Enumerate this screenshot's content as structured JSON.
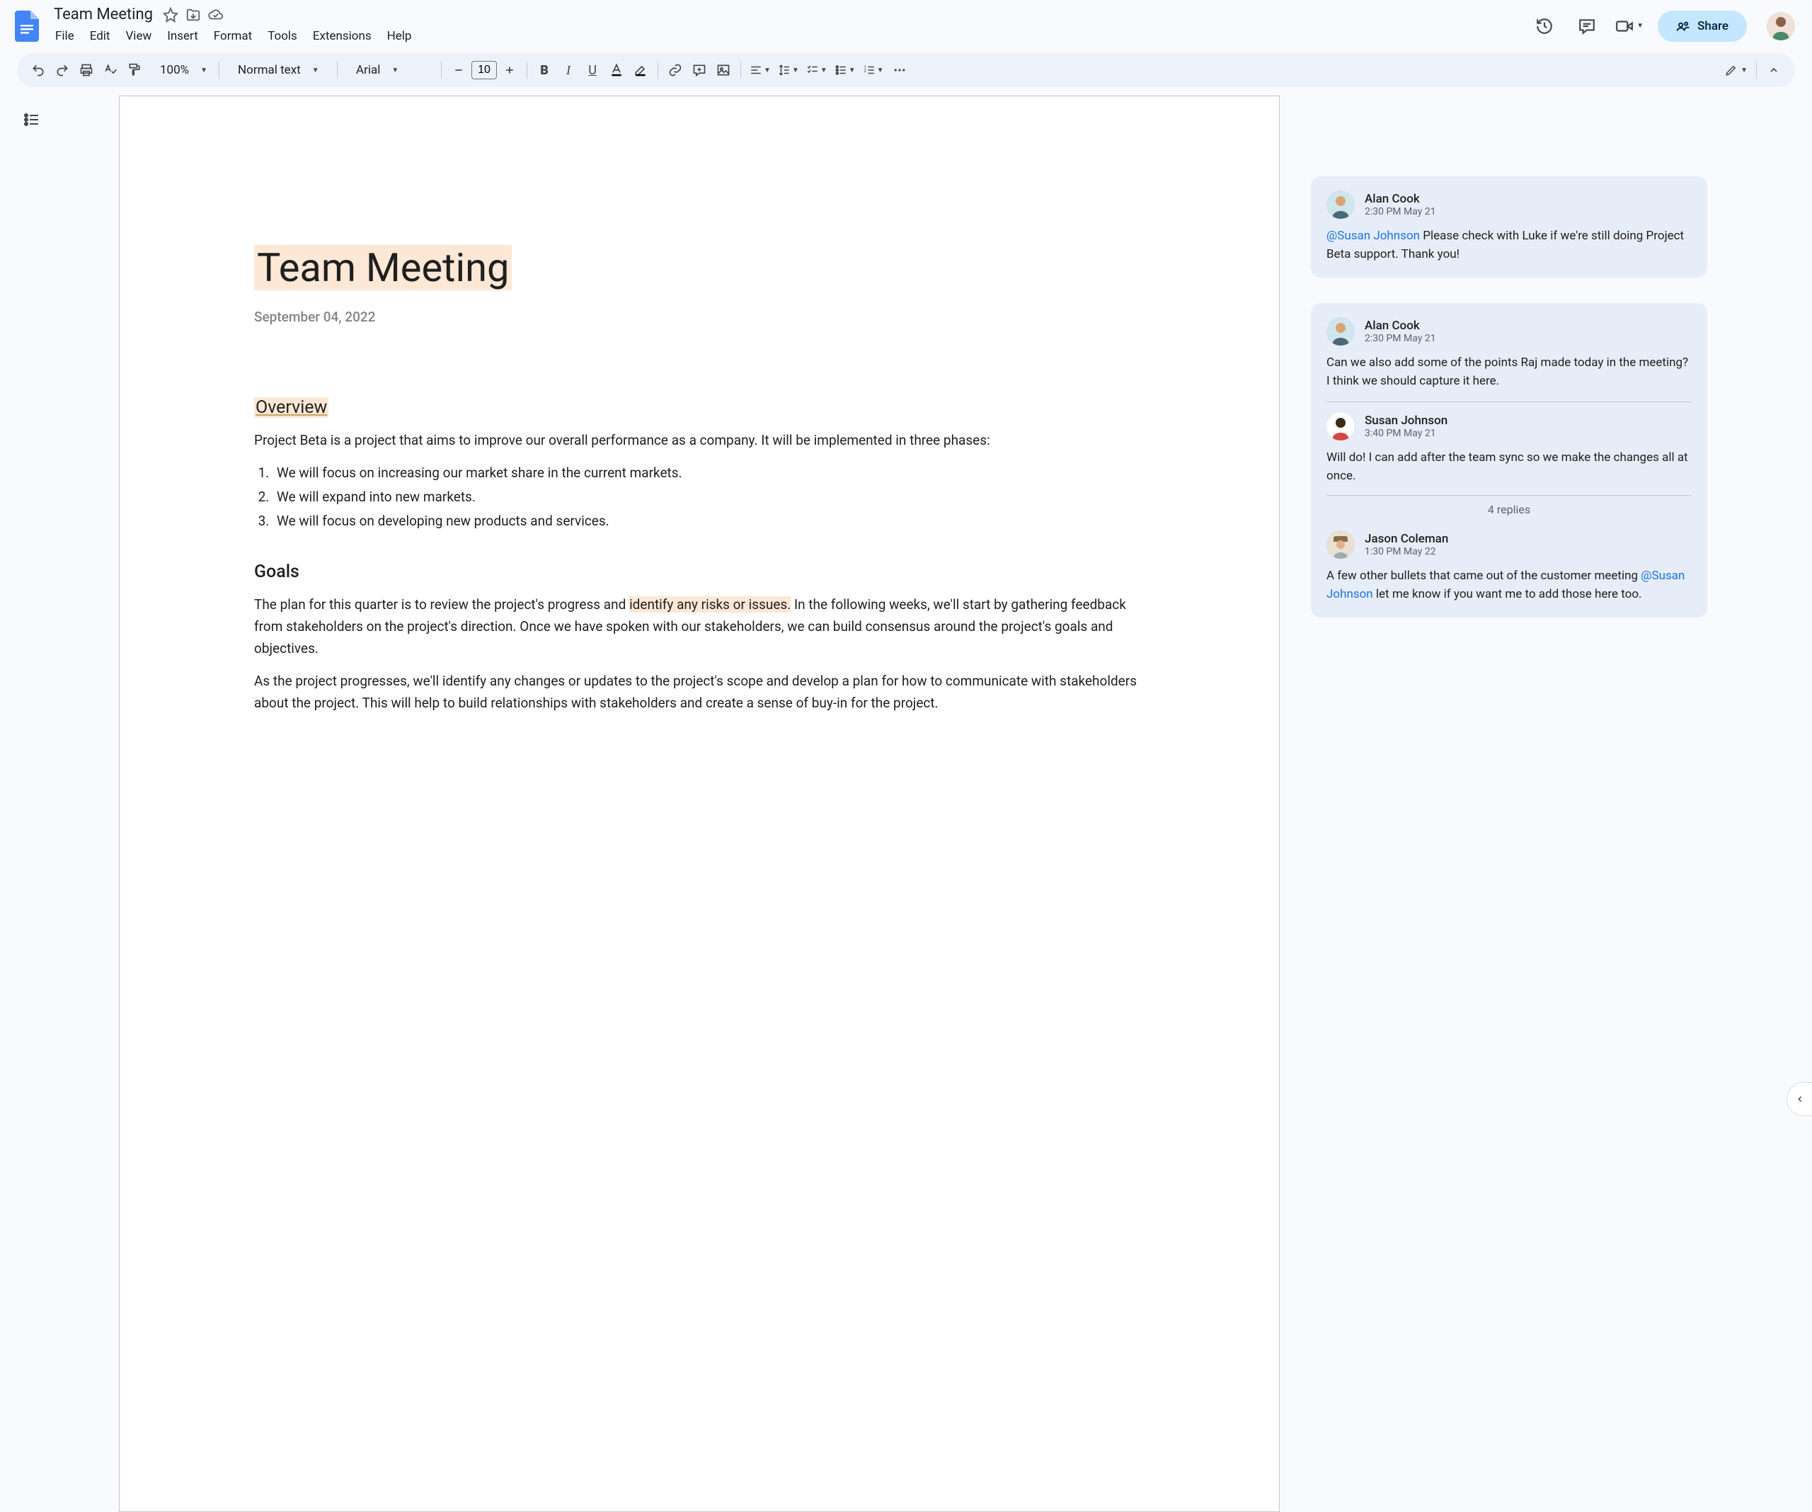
{
  "header": {
    "doc_title": "Team Meeting",
    "menus": [
      "File",
      "Edit",
      "View",
      "Insert",
      "Format",
      "Tools",
      "Extensions",
      "Help"
    ],
    "share_label": "Share"
  },
  "toolbar": {
    "zoom": "100%",
    "style": "Normal text",
    "font": "Arial",
    "font_size": "10"
  },
  "document": {
    "title": "Team Meeting",
    "date": "September 04, 2022",
    "overview_heading": "Overview",
    "overview_text": "Project Beta is a project that aims to improve our overall performance as a company. It will be implemented in three phases:",
    "phases": [
      "We will focus on increasing our market share in the current markets.",
      "We will expand into new markets.",
      "We will focus on developing new products and services."
    ],
    "goals_heading": "Goals",
    "goals_p1_pre": "The plan for this quarter is to review the project's progress and ",
    "goals_p1_hl": "identify any risks or issues.",
    "goals_p1_post": " In the following weeks, we'll start by gathering feedback from stakeholders on the project's direction. Once we have spoken with our stakeholders, we can build consensus around the project's goals and objectives.",
    "goals_p2": "As the project progresses, we'll identify any changes or updates to the project's scope and develop a plan for how to communicate with stakeholders about the project. This will help to build relationships with stakeholders and create a sense of buy-in for the project."
  },
  "comments": {
    "c1": {
      "author": "Alan Cook",
      "time": "2:30 PM May 21",
      "mention": "@Susan Johnson",
      "body": " Please check with Luke if we're still doing Project Beta support. Thank you!"
    },
    "c2": {
      "author": "Alan Cook",
      "time": "2:30 PM May 21",
      "body": "Can we also add some of the points Raj made today in the meeting? I think we should capture it here.",
      "reply1": {
        "author": "Susan Johnson",
        "time": "3:40 PM May 21",
        "body": "Will do! I can add after the team sync so we make the changes all at once."
      },
      "replies_label": "4 replies",
      "reply2": {
        "author": "Jason Coleman",
        "time": "1:30 PM May 22",
        "body_pre": "A few other bullets that came out of the customer meeting ",
        "mention": "@Susan Johnson",
        "body_post": " let me know if you want me to add those here too."
      }
    }
  }
}
